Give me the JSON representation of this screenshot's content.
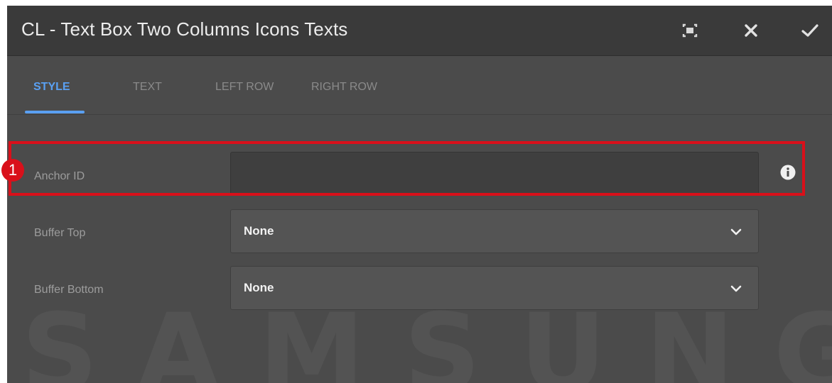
{
  "dialog": {
    "title": "CL - Text Box Two Columns Icons Texts",
    "buttons": {
      "fullscreen_icon": "fullscreen-icon",
      "close_icon": "close-icon",
      "confirm_icon": "check-icon"
    }
  },
  "tabs": [
    {
      "label": "STYLE",
      "active": true
    },
    {
      "label": "TEXT",
      "active": false
    },
    {
      "label": "LEFT ROW",
      "active": false
    },
    {
      "label": "RIGHT ROW",
      "active": false
    }
  ],
  "fields": {
    "anchor_id": {
      "label": "Anchor ID",
      "value": "",
      "info_icon": "info-icon"
    },
    "buffer_top": {
      "label": "Buffer Top",
      "value": "None"
    },
    "buffer_bottom": {
      "label": "Buffer Bottom",
      "value": "None"
    }
  },
  "annotation": {
    "callout_number": "1",
    "color": "#d9101a"
  },
  "watermark": {
    "text": "SAMSUNG"
  },
  "colors": {
    "accent": "#5aa0f2",
    "background": "#4b4b4b",
    "titlebar": "#3a3a3a"
  }
}
